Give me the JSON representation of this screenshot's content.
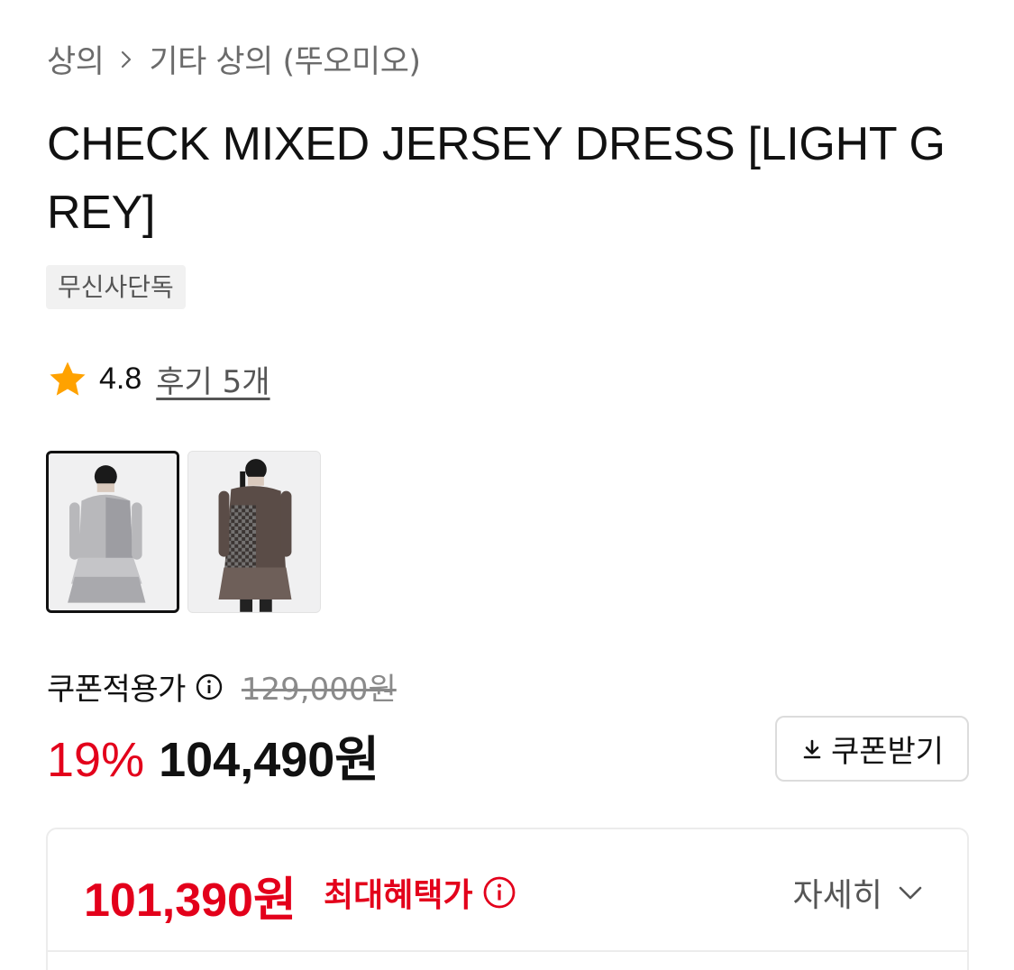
{
  "breadcrumb": {
    "category": "상의",
    "subcategory": "기타 상의 (뚜오미오)"
  },
  "product": {
    "title": "CHECK MIXED JERSEY DRESS [LIGHT GREY]",
    "badge": "무신사단독"
  },
  "rating": {
    "score": "4.8",
    "reviews_label": "후기 5개"
  },
  "thumbnails": [
    {
      "alt": "light grey dress front",
      "selected": true
    },
    {
      "alt": "brown check dress",
      "selected": false
    }
  ],
  "pricing": {
    "coupon_label": "쿠폰적용가",
    "original_price": "129,000원",
    "discount": "19%",
    "final_price": "104,490원",
    "coupon_button": "쿠폰받기"
  },
  "benefit": {
    "max_price": "101,390원",
    "max_label": "최대혜택가",
    "detail_label": "자세히"
  },
  "colors": {
    "accent_red": "#e3001b",
    "star": "#ffa200",
    "text": "#111111",
    "muted": "#6b6b6b"
  },
  "icons": [
    "chevron-right-icon",
    "star-icon",
    "info-icon",
    "download-icon",
    "chevron-down-icon"
  ]
}
